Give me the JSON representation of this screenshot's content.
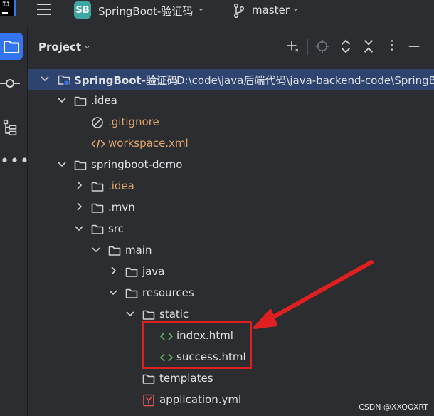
{
  "titlebar": {
    "project_badge": "SB",
    "project_name": "SpringBoot-验证码",
    "branch": "master"
  },
  "panel": {
    "title": "Project"
  },
  "tree": [
    {
      "label": "SpringBoot-验证码",
      "path": "D:\\code\\java后端代码\\java-backend-code\\SpringB",
      "depth": 0,
      "expanded": true,
      "type": "module",
      "bold": true,
      "selected": true
    },
    {
      "label": ".idea",
      "depth": 1,
      "expanded": true,
      "type": "folder"
    },
    {
      "label": ".gitignore",
      "depth": 2,
      "type": "ignore-file",
      "ignored": true
    },
    {
      "label": "workspace.xml",
      "depth": 2,
      "type": "xml-file",
      "ignored": true
    },
    {
      "label": "springboot-demo",
      "depth": 1,
      "expanded": true,
      "type": "folder"
    },
    {
      "label": ".idea",
      "depth": 2,
      "expanded": false,
      "type": "folder",
      "ignored": true
    },
    {
      "label": ".mvn",
      "depth": 2,
      "expanded": false,
      "type": "folder"
    },
    {
      "label": "src",
      "depth": 2,
      "expanded": true,
      "type": "folder"
    },
    {
      "label": "main",
      "depth": 3,
      "expanded": true,
      "type": "folder"
    },
    {
      "label": "java",
      "depth": 4,
      "expanded": false,
      "type": "folder"
    },
    {
      "label": "resources",
      "depth": 4,
      "expanded": true,
      "type": "folder"
    },
    {
      "label": "static",
      "depth": 5,
      "expanded": true,
      "type": "folder"
    },
    {
      "label": "index.html",
      "depth": 6,
      "type": "html-file"
    },
    {
      "label": "success.html",
      "depth": 6,
      "type": "html-file"
    },
    {
      "label": "templates",
      "depth": 5,
      "type": "folder"
    },
    {
      "label": "application.yml",
      "depth": 5,
      "type": "yml-file"
    }
  ],
  "watermark": "CSDN @XXOOXRT",
  "colors": {
    "background": "#2b2d30",
    "selection": "#2e436e",
    "accent": "#3574f0",
    "ignored_text": "#e0a56c",
    "html_icon": "#5fb85f",
    "yml_icon": "#e05555",
    "highlight": "#e02020"
  }
}
